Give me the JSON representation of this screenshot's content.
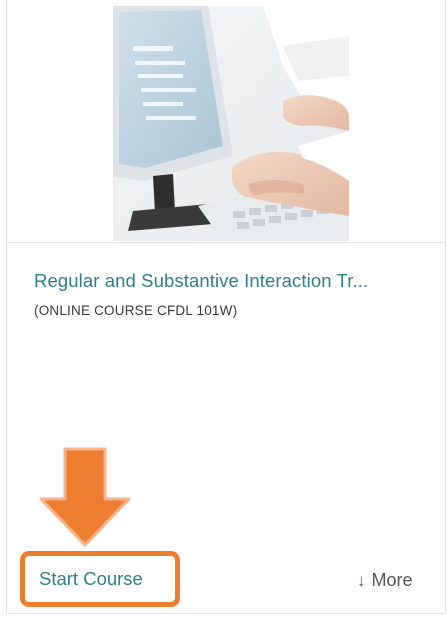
{
  "course": {
    "title": "Regular and Substantive Interaction Tr...",
    "subtitle": "(ONLINE COURSE CFDL 101W)",
    "image_icon": "computer-keyboard-photo"
  },
  "actions": {
    "start_label": "Start Course",
    "more_label": "More",
    "more_icon": "down-arrow-icon"
  },
  "annotation": {
    "pointer_icon": "orange-down-arrow",
    "highlight_color": "#ed7d31"
  },
  "colors": {
    "link": "#2f7e8c",
    "text": "#3a3a3a",
    "accent": "#ed7d31"
  }
}
